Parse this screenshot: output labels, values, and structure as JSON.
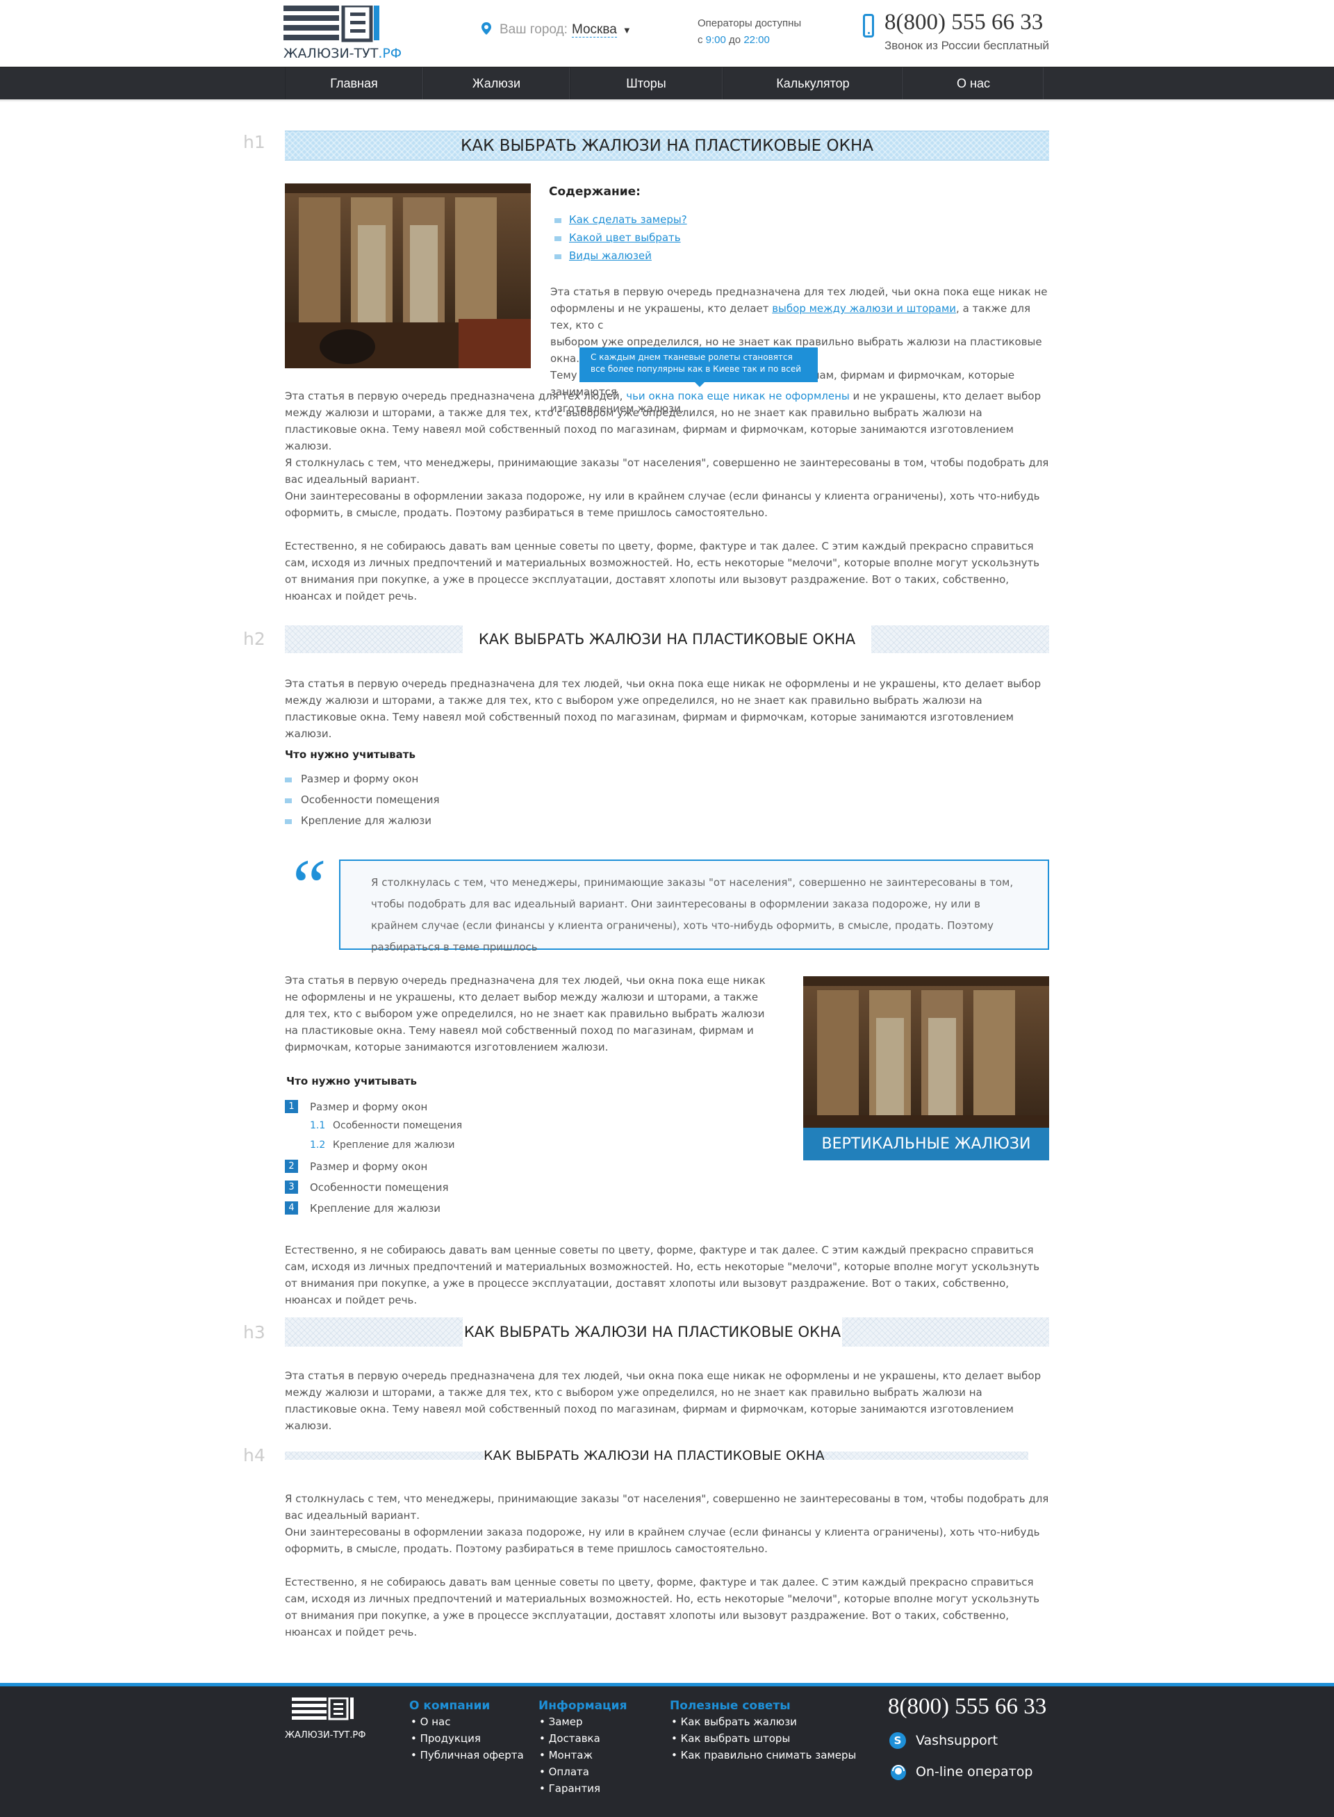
{
  "header": {
    "logo_text": "ЖАЛЮЗИ-ТУТ",
    "logo_rf": ".РФ",
    "city_label": "Ваш город:",
    "city_value": "Москва",
    "operators_label": "Операторы доступны",
    "operators_from": "с",
    "operators_start": "9:00",
    "operators_to": "до",
    "operators_end": "22:00",
    "phone": "8(800) 555 66 33",
    "phone_sub": "Звонок из России бесплатный"
  },
  "nav": {
    "items": [
      {
        "label": "Главная"
      },
      {
        "label": "Жалюзи"
      },
      {
        "label": "Шторы"
      },
      {
        "label": "Калькулятор"
      },
      {
        "label": "О нас"
      }
    ]
  },
  "labels": {
    "h1": "h1",
    "h2": "h2",
    "h3": "h3",
    "h4": "h4"
  },
  "titles": {
    "h1": "КАК ВЫБРАТЬ ЖАЛЮЗИ НА ПЛАСТИКОВЫЕ ОКНА",
    "h2": "КАК ВЫБРАТЬ ЖАЛЮЗИ НА ПЛАСТИКОВЫЕ ОКНА",
    "h3": "КАК ВЫБРАТЬ ЖАЛЮЗИ НА ПЛАСТИКОВЫЕ ОКНА",
    "h4": "КАК ВЫБРАТЬ ЖАЛЮЗИ НА ПЛАСТИКОВЫЕ ОКНА"
  },
  "toc": {
    "title": "Содержание:",
    "items": [
      "Как сделать замеры?",
      "Какой цвет выбрать",
      "Виды жалюзей"
    ]
  },
  "intro": {
    "l1": "Эта статья в первую очередь предназначена для тех людей, чьи окна пока еще никак не",
    "l2_a": "оформлены и не украшены, кто делает ",
    "l2_link": "выбор между жалюзи и шторами",
    "l2_b": ", а также для тех, кто с",
    "l3": "выбором уже определился, но не знает как правильно выбрать жалюзи на пластиковые окна.",
    "l4": "Тему навеял мой собственный поход по магазинам, фирмам и фирмочкам, которые занимаются",
    "l5": "изготовлением жалюзи."
  },
  "tooltip": "С каждым днем тканевые ролеты становятся все более популярны как в Киеве так и по всей",
  "para1": {
    "a": "Эта статья в первую очередь предназначена для тех людей, ",
    "link": "чьи окна пока еще никак не оформлены",
    "b": " и не украшены, кто делает выбор между жалюзи и шторами, а также для тех, кто с выбором уже определился, но не знает как правильно выбрать жалюзи на пластиковые окна. Тему навеял мой собственный поход по магазинам, фирмам и фирмочкам, которые занимаются изготовлением жалюзи."
  },
  "para2": "Я столкнулась с тем, что менеджеры, принимающие заказы \"от населения\", совершенно не заинтересованы в том, чтобы подобрать для вас идеальный вариант.",
  "para2b": "Они заинтересованы в оформлении заказа подороже, ну или в крайнем случае (если финансы у клиента ограничены), хоть что-нибудь оформить, в смысле, продать. Поэтому разбираться в теме пришлось самостоятельно.",
  "para3": "Естественно, я не собираюсь давать вам ценные советы по цвету, форме, фактуре и так далее. С этим каждый прекрасно справиться сам, исходя из личных предпочтений и материальных возможностей. Но, есть некоторые \"мелочи\", которые вполне могут ускользнуть от внимания при покупке, а уже в процессе эксплуатации, доставят хлопоты или вызовут раздражение. Вот о таких, собственно, нюансах и пойдет речь.",
  "h2_para": "Эта статья в первую очередь предназначена для тех людей, чьи окна пока еще никак не оформлены и не украшены, кто делает выбор между жалюзи и шторами, а также для тех, кто с выбором уже определился, но не знает как правильно выбрать жалюзи на пластиковые окна. Тему навеял мой собственный поход по магазинам, фирмам и фирмочкам, которые занимаются изготовлением жалюзи.",
  "consider": {
    "title": "Что нужно учитывать",
    "items": [
      "Размер и форму окон",
      "Особенности помещения",
      "Крепление для жалюзи"
    ]
  },
  "quote": "Я столкнулась с тем, что менеджеры, принимающие заказы \"от населения\", совершенно не заинтересованы в том, чтобы подобрать для вас идеальный вариант. Они заинтересованы в оформлении заказа подороже, ну или в крайнем случае (если финансы у клиента ограничены), хоть что-нибудь оформить, в смысле, продать. Поэтому разбираться в теме пришлось",
  "left_para": "Эта статья в первую очередь предназначена для тех людей, чьи окна пока еще никак не оформлены и не украшены, кто делает выбор между жалюзи и шторами, а также для тех, кто с выбором уже определился, но не знает как правильно выбрать жалюзи на пластиковые окна. Тему навеял мой собственный поход по магазинам, фирмам и фирмочкам, которые занимаются изготовлением жалюзи.",
  "numbered": {
    "title": "Что нужно учитывать",
    "items": [
      {
        "n": "1",
        "label": "Размер и форму окон"
      },
      {
        "n": "1.1",
        "label": "Особенности помещения"
      },
      {
        "n": "1.2",
        "label": "Крепление для жалюзи"
      },
      {
        "n": "2",
        "label": "Размер и форму окон"
      },
      {
        "n": "3",
        "label": "Особенности помещения"
      },
      {
        "n": "4",
        "label": "Крепление для жалюзи"
      }
    ]
  },
  "caption": "ВЕРТИКАЛЬНЫЕ ЖАЛЮЗИ",
  "para_after_list": "Естественно, я не собираюсь давать вам ценные советы по цвету, форме, фактуре и так далее. С этим каждый прекрасно справиться сам, исходя из личных предпочтений и материальных возможностей. Но, есть некоторые \"мелочи\", которые вполне могут ускользнуть от внимания при покупке, а уже в процессе эксплуатации, доставят хлопоты или вызовут раздражение. Вот о таких, собственно, нюансах и пойдет речь.",
  "h3_para": "Эта статья в первую очередь предназначена для тех людей, чьи окна пока еще никак не оформлены и не украшены, кто делает выбор между жалюзи и шторами, а также для тех, кто с выбором уже определился, но не знает как правильно выбрать жалюзи на пластиковые окна. Тему навеял мой собственный поход по магазинам, фирмам и фирмочкам, которые занимаются изготовлением жалюзи.",
  "h4_para1": "Я столкнулась с тем, что менеджеры, принимающие заказы \"от населения\", совершенно не заинтересованы в том, чтобы подобрать для вас идеальный вариант.",
  "h4_para1b": "Они заинтересованы в оформлении заказа подороже, ну или в крайнем случае (если финансы у клиента ограничены), хоть что-нибудь оформить, в смысле, продать. Поэтому разбираться в теме пришлось самостоятельно.",
  "h4_para2": "Естественно, я не собираюсь давать вам ценные советы по цвету, форме, фактуре и так далее. С этим каждый прекрасно справиться сам, исходя из личных предпочтений и материальных возможностей. Но, есть некоторые \"мелочи\", которые вполне могут ускользнуть от внимания при покупке, а уже в процессе эксплуатации, доставят хлопоты или вызовут раздражение. Вот о таких, собственно, нюансах и пойдет речь.",
  "footer": {
    "logo_text": "ЖАЛЮЗИ-ТУТ.РФ",
    "col1": {
      "title": "О компании",
      "items": [
        "• О нас",
        "• Продукция",
        "• Публичная оферта"
      ]
    },
    "col2": {
      "title": "Информация",
      "items": [
        "• Замер",
        "• Доставка",
        "• Монтаж",
        "• Оплата",
        "• Гарантия"
      ]
    },
    "col3": {
      "title": "Полезные советы",
      "items": [
        "• Как выбрать жалюзи",
        "• Как выбрать шторы",
        "• Как правильно снимать замеры"
      ]
    },
    "phone": "8(800) 555 66 33",
    "skype": "Vashsupport",
    "online": "On-line оператор"
  },
  "colors": {
    "accent": "#1e90d8",
    "nav": "#2c2e33",
    "footer": "#26282d"
  }
}
